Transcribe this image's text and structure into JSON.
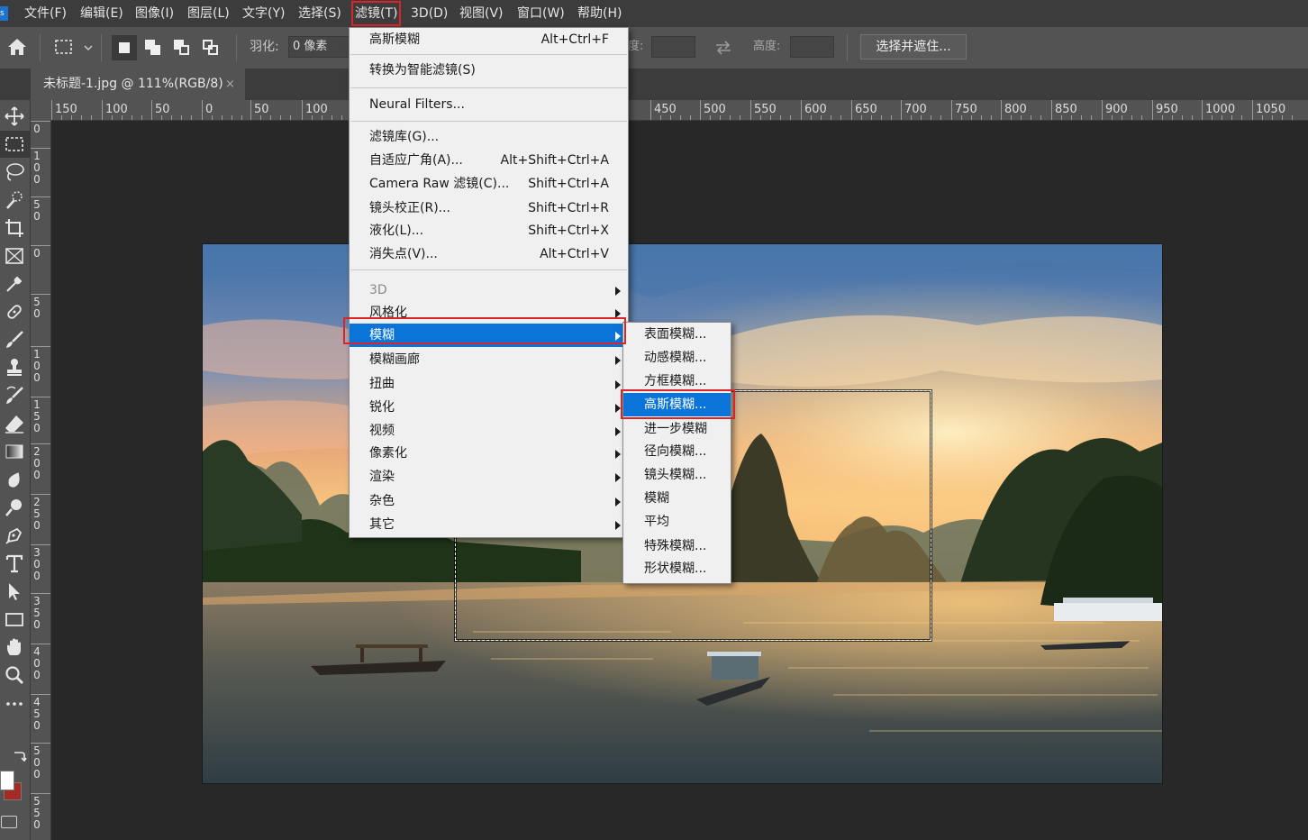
{
  "app": {
    "logo_text": "s"
  },
  "menubar": {
    "items": [
      {
        "label": "文件(F)"
      },
      {
        "label": "编辑(E)"
      },
      {
        "label": "图像(I)"
      },
      {
        "label": "图层(L)"
      },
      {
        "label": "文字(Y)"
      },
      {
        "label": "选择(S)"
      },
      {
        "label": "滤镜(T)"
      },
      {
        "label": "3D(D)"
      },
      {
        "label": "视图(V)"
      },
      {
        "label": "窗口(W)"
      },
      {
        "label": "帮助(H)"
      }
    ],
    "active_item": "滤镜(T)"
  },
  "options_bar": {
    "feather_label": "羽化:",
    "feather_value": "0 像素",
    "width_label": "度:",
    "height_label": "高度:",
    "select_mask_label": "选择并遮住..."
  },
  "document_tab": {
    "title": "未标题-1.jpg @ 111%(RGB/8)",
    "close_glyph": "×"
  },
  "rulers": {
    "horizontal_labels": [
      "150",
      "100",
      "50",
      "0",
      "50",
      "100",
      "450",
      "500",
      "550",
      "600",
      "650",
      "700",
      "750",
      "800",
      "850",
      "900",
      "950",
      "1000",
      "1050"
    ],
    "vertical_labels": [
      "0",
      "1\n0\n0",
      "5\n0",
      "0",
      "5\n0",
      "1\n0\n0",
      "1\n5\n0",
      "2\n0\n0",
      "2\n5\n0",
      "3\n0\n0",
      "3\n5\n0",
      "4\n0\n0",
      "4\n5\n0",
      "5\n0\n0",
      "5\n5\n0"
    ]
  },
  "filter_menu": {
    "last_filter": {
      "label": "高斯模糊",
      "shortcut": "Alt+Ctrl+F"
    },
    "convert_smart": {
      "label": "转换为智能滤镜(S)"
    },
    "neural": {
      "label": "Neural Filters..."
    },
    "filter_gallery": {
      "label": "滤镜库(G)..."
    },
    "adaptive_wide": {
      "label": "自适应广角(A)...",
      "shortcut": "Alt+Shift+Ctrl+A"
    },
    "camera_raw": {
      "label": "Camera Raw 滤镜(C)...",
      "shortcut": "Shift+Ctrl+A"
    },
    "lens_correction": {
      "label": "镜头校正(R)...",
      "shortcut": "Shift+Ctrl+R"
    },
    "liquify": {
      "label": "液化(L)...",
      "shortcut": "Shift+Ctrl+X"
    },
    "vanishing_point": {
      "label": "消失点(V)...",
      "shortcut": "Alt+Ctrl+V"
    },
    "submenus": [
      {
        "label": "3D",
        "disabled": true
      },
      {
        "label": "风格化"
      },
      {
        "label": "模糊",
        "highlighted": true
      },
      {
        "label": "模糊画廊"
      },
      {
        "label": "扭曲"
      },
      {
        "label": "锐化"
      },
      {
        "label": "视频"
      },
      {
        "label": "像素化"
      },
      {
        "label": "渲染"
      },
      {
        "label": "杂色"
      },
      {
        "label": "其它"
      }
    ]
  },
  "blur_submenu": {
    "items": [
      {
        "label": "表面模糊..."
      },
      {
        "label": "动感模糊..."
      },
      {
        "label": "方框模糊..."
      },
      {
        "label": "高斯模糊...",
        "highlighted": true
      },
      {
        "label": "进一步模糊"
      },
      {
        "label": "径向模糊..."
      },
      {
        "label": "镜头模糊..."
      },
      {
        "label": "模糊"
      },
      {
        "label": "平均"
      },
      {
        "label": "特殊模糊..."
      },
      {
        "label": "形状模糊..."
      }
    ]
  },
  "colors": {
    "menu_highlight": "#0a74d8",
    "annotation_red": "#d9242a",
    "foreground_swatch": "#ffffff",
    "background_swatch": "#a32b23"
  },
  "icons": {
    "toolbar": [
      "move-icon",
      "marquee-icon",
      "lasso-icon",
      "quick-select-icon",
      "crop-icon",
      "frame-icon",
      "eyedropper-icon",
      "healing-brush-icon",
      "brush-icon",
      "clone-stamp-icon",
      "history-brush-icon",
      "eraser-icon",
      "gradient-icon",
      "blur-tool-icon",
      "dodge-icon",
      "pen-icon",
      "type-icon",
      "path-select-icon",
      "rectangle-icon",
      "hand-icon",
      "zoom-icon",
      "more-tools-icon"
    ]
  }
}
